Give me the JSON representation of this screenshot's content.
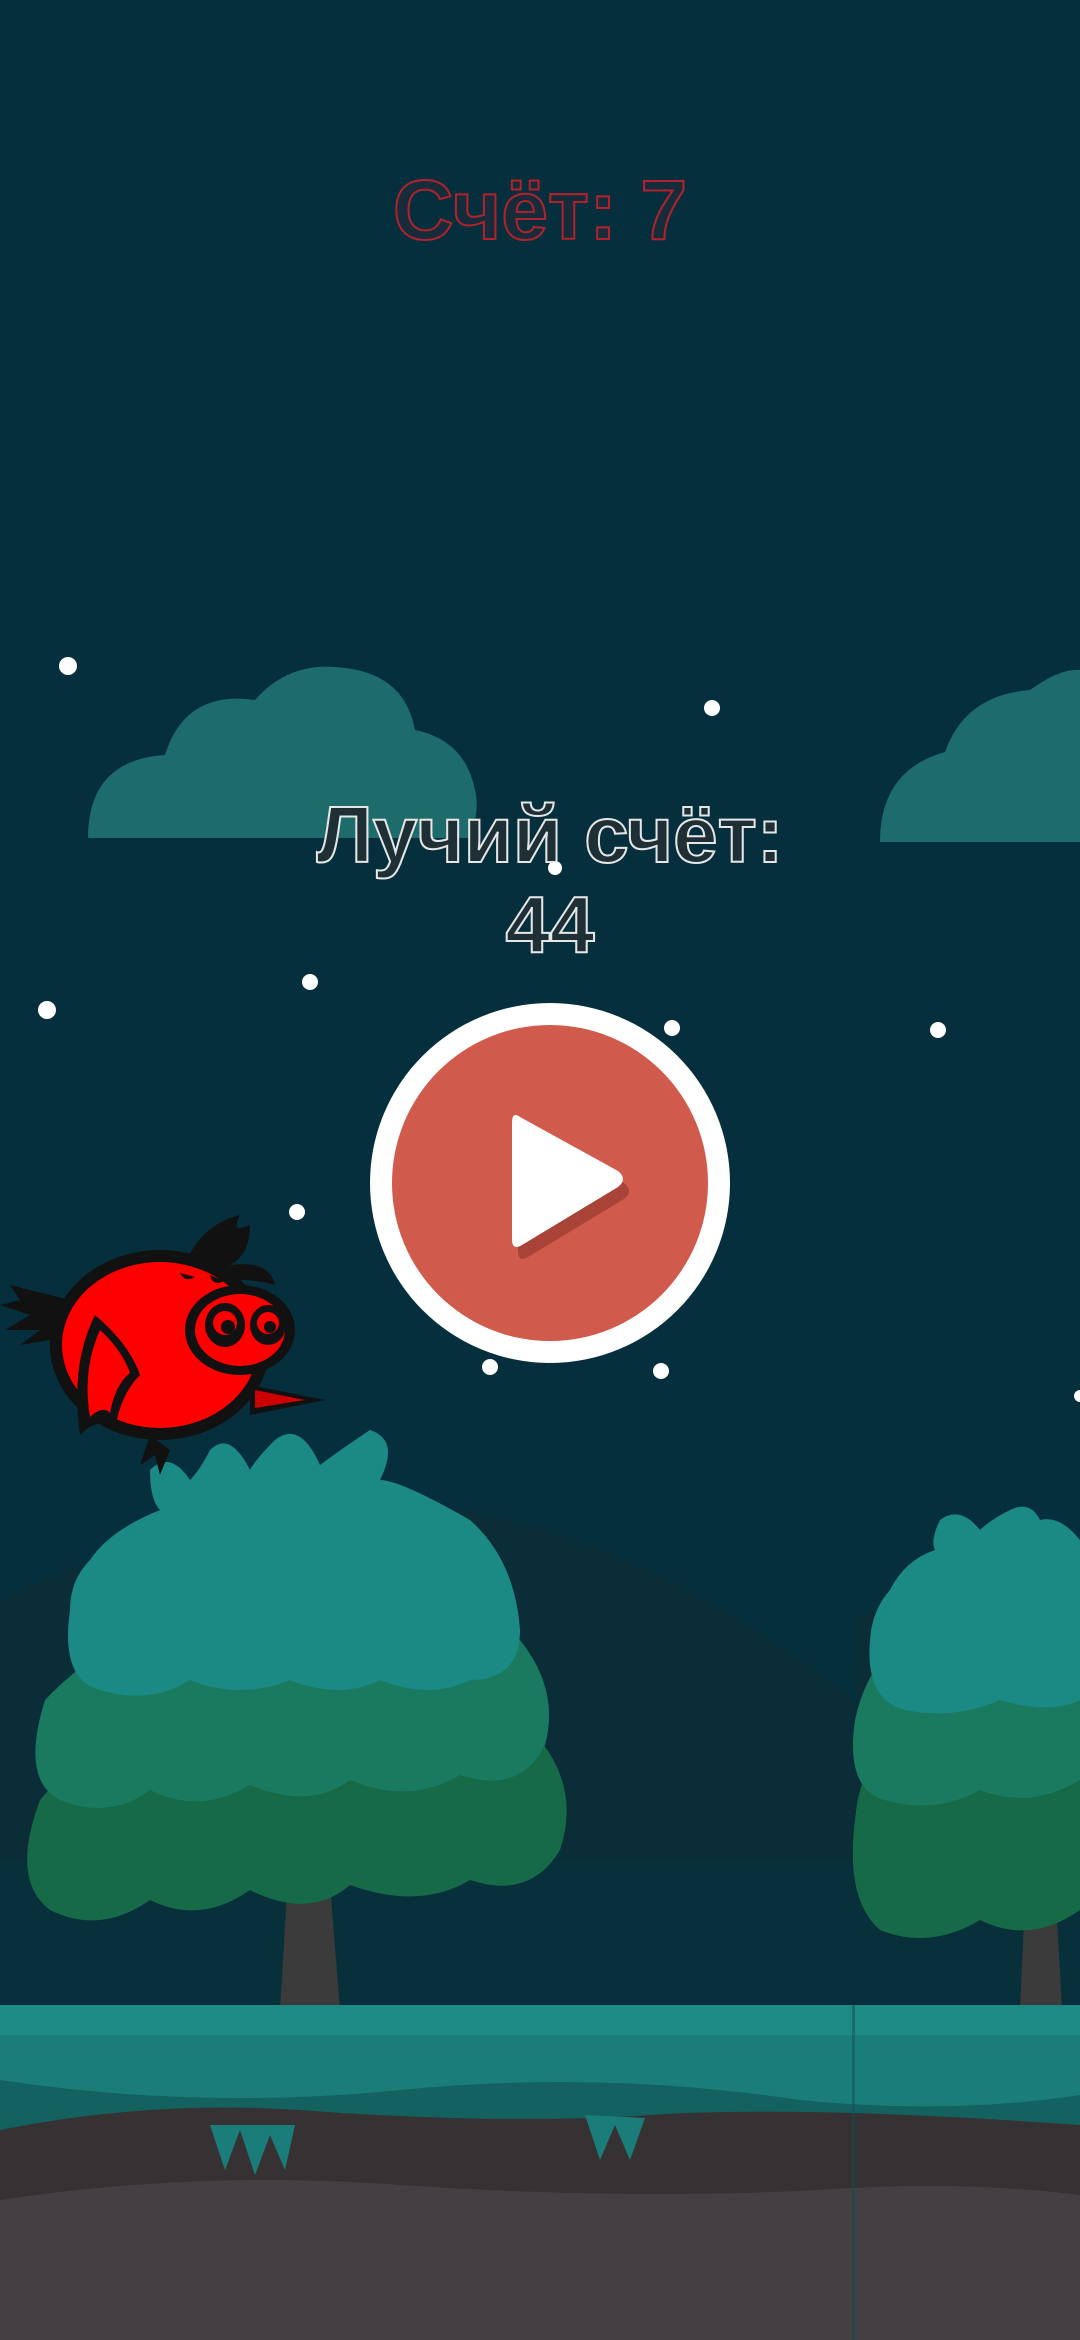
{
  "hud": {
    "score_label": "Счёт: 7"
  },
  "menu": {
    "best_score_label": "Лучий счёт:",
    "best_score_value": "44",
    "play_button_icon": "play-icon"
  },
  "player": {
    "sprite": "red-bird"
  },
  "colors": {
    "sky": "#062f3e",
    "cloud": "#1e6b6b",
    "tree_top": "#1b8a85",
    "tree_mid": "#1a7a60",
    "tree_bottom": "#176a48",
    "ground_grass": "#1b7d7a",
    "ground_dirt": "#433f42",
    "play_button": "#d05b4c",
    "bird": "#ff0000",
    "score_outline": "#b2222c"
  }
}
